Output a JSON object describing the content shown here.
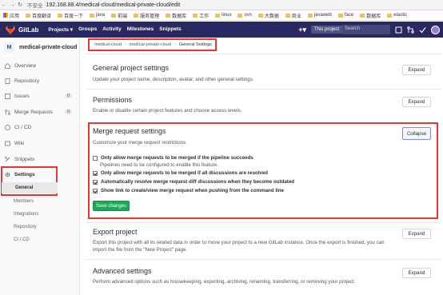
{
  "browser": {
    "security": "不安全",
    "url": "192.168.88.4/medical-cloud/medical-private-cloud/edit",
    "bookmarks": [
      "应用",
      "百度翻译",
      "百度一下",
      "java",
      "前端",
      "服务管理",
      "数据库",
      "工作",
      "linux",
      "svn",
      "大数据",
      "商业",
      "javaweb",
      "face",
      "数据库",
      "elastic"
    ]
  },
  "header": {
    "brand": "GitLab",
    "nav": [
      "Projects ▾",
      "Groups",
      "Activity",
      "Milestones",
      "Snippets"
    ],
    "this_project": "This project",
    "search_placeholder": "Search"
  },
  "sidebar": {
    "project_initial": "M",
    "project_name": "medical-private-cloud",
    "items": [
      {
        "label": "Overview",
        "icon": "home-icon"
      },
      {
        "label": "Repository",
        "icon": "book-icon"
      },
      {
        "label": "Issues",
        "icon": "issues-icon",
        "badge": "0"
      },
      {
        "label": "Merge Requests",
        "icon": "merge-icon",
        "badge": "0"
      },
      {
        "label": "CI / CD",
        "icon": "rocket-icon"
      },
      {
        "label": "Wiki",
        "icon": "wiki-icon"
      },
      {
        "label": "Snippets",
        "icon": "snippet-icon"
      },
      {
        "label": "Settings",
        "icon": "gear-icon"
      }
    ],
    "settings_sub": [
      "General",
      "Members",
      "Integrations",
      "Repository",
      "CI / CD"
    ]
  },
  "breadcrumb": [
    "medical-cloud",
    "medical-private-cloud",
    "General Settings"
  ],
  "sections": {
    "general": {
      "title": "General project settings",
      "desc": "Update your project name, description, avatar, and other general settings.",
      "button": "Expand"
    },
    "permissions": {
      "title": "Permissions",
      "desc": "Enable or disable certain project features and choose access levels.",
      "button": "Expand"
    },
    "merge": {
      "title": "Merge request settings",
      "desc": "Customize your merge request restrictions.",
      "button": "Collapse",
      "options": [
        {
          "label": "Only allow merge requests to be merged if the pipeline succeeds",
          "checked": false
        },
        {
          "label": "Only allow merge requests to be merged if all discussions are resolved",
          "checked": true
        },
        {
          "label": "Automatically resolve merge request diff discussions when they become outdated",
          "checked": true
        },
        {
          "label": "Show link to create/view merge request when pushing from the command line",
          "checked": true
        }
      ],
      "pipeline_help": "Pipelines need to be configured to enable this feature.",
      "save": "Save changes"
    },
    "export": {
      "title": "Export project",
      "desc1": "Export this project with all its related data in order to move your project to a new GitLab instance. Once the export is finished, you can",
      "desc2": "import the file from the \"New Project\" page.",
      "button": "Expand"
    },
    "advanced": {
      "title": "Advanced settings",
      "desc": "Perform advanced options such as housekeeping, exporting, archiving, renaming, transferring, or removing your project.",
      "button": "Expand"
    }
  },
  "colors": {
    "header": "#292961",
    "save": "#1aaa55",
    "highlight": "#ee3333"
  }
}
